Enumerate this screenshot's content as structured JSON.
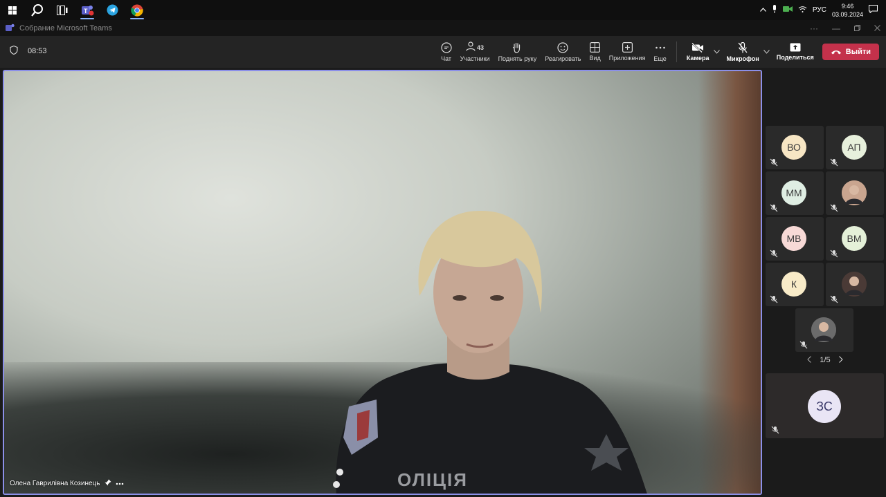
{
  "taskbar": {
    "icons": [
      "windows-start-icon",
      "search-icon",
      "task-view-icon",
      "teams-icon",
      "telegram-icon",
      "chrome-icon"
    ],
    "tray": {
      "lang": "РУС",
      "time": "9:46",
      "date": "03.09.2024"
    }
  },
  "window": {
    "title": "Собрание Microsoft Teams"
  },
  "meeting": {
    "elapsed": "08:53",
    "toolbar": {
      "chat": "Чат",
      "participants": "Участники",
      "participants_count": "43",
      "raise_hand": "Поднять руку",
      "react": "Реагировать",
      "view": "Вид",
      "apps": "Приложения",
      "more": "Еще",
      "camera": "Камера",
      "mic": "Микрофон",
      "share": "Поделиться",
      "leave": "Выйти"
    },
    "speaker_name": "Олена Гаврилівна Козинець",
    "uniform_text": "ОЛІЦІЯ",
    "tiles": [
      {
        "initials": "ВО",
        "color": "#f7e6c4"
      },
      {
        "initials": "АП",
        "color": "#e7f0dc"
      },
      {
        "initials": "ММ",
        "color": "#dfeee3"
      },
      {
        "initials": "",
        "color": "#c9a58f",
        "photo": true
      },
      {
        "initials": "МВ",
        "color": "#f7d9d6"
      },
      {
        "initials": "ВМ",
        "color": "#e4f0d8"
      },
      {
        "initials": "К",
        "color": "#f8ebc8"
      },
      {
        "initials": "",
        "color": "#4a3a36",
        "photo": true
      },
      {
        "initials": "",
        "color": "#6b6b6b",
        "photo": true
      }
    ],
    "pager": "1/5",
    "bottom_tile": {
      "initials": "ЗС"
    }
  },
  "colors": {
    "accent": "#8b8fe8",
    "leave": "#c4314b"
  }
}
